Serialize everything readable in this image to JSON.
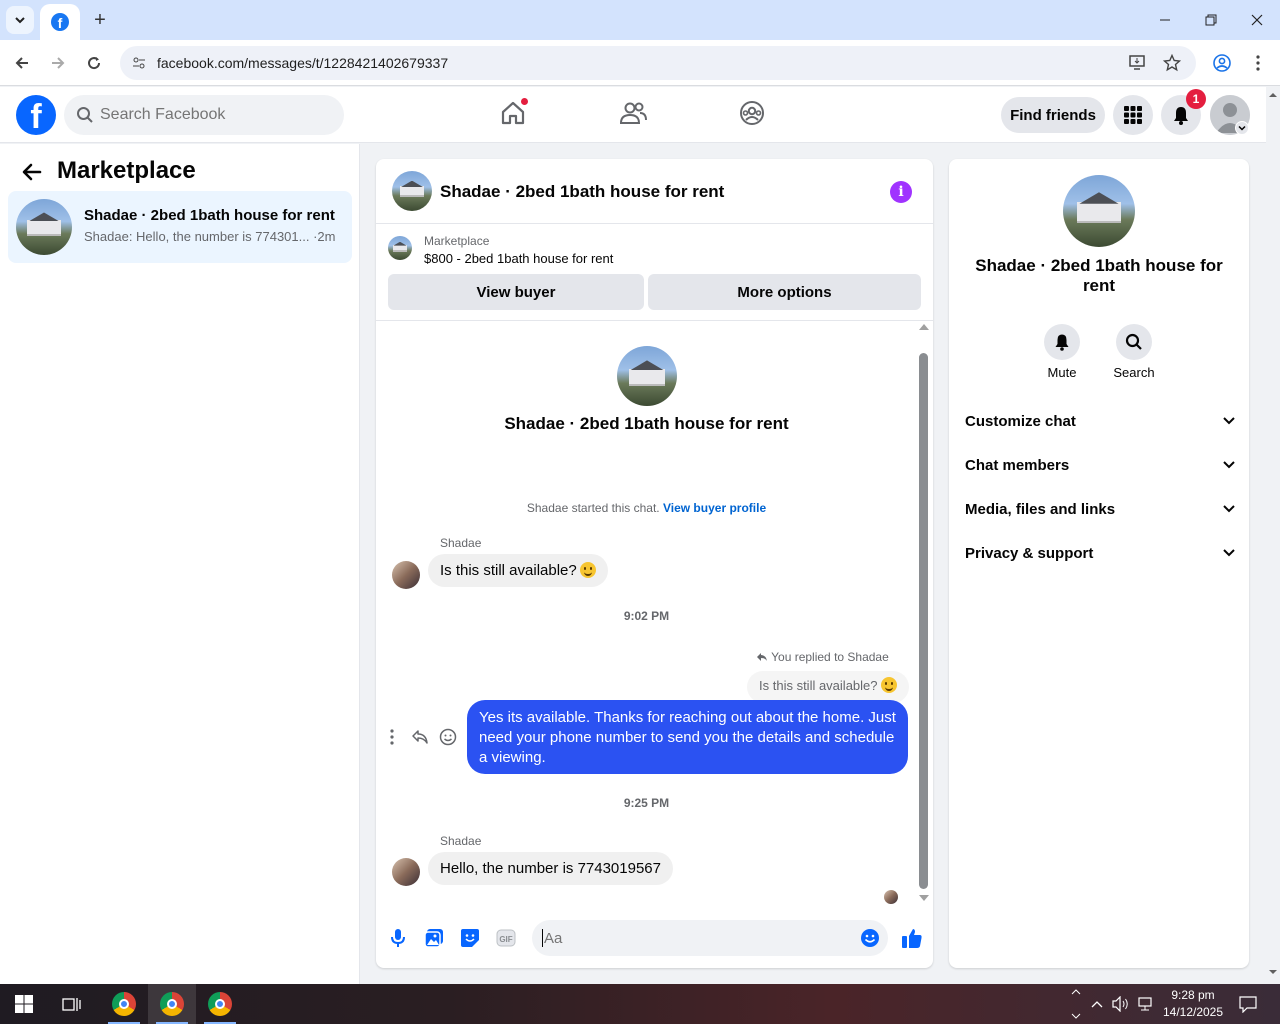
{
  "browser": {
    "url": "facebook.com/messages/t/1228421402679337"
  },
  "header": {
    "search_placeholder": "Search Facebook",
    "find_friends": "Find friends",
    "notif_count": "1"
  },
  "left": {
    "title": "Marketplace",
    "conversation": {
      "name": "Shadae · 2bed 1bath house for rent",
      "preview": "Shadae: Hello, the number is 774301... ·2m"
    }
  },
  "chat": {
    "title": "Shadae · 2bed 1bath house for rent",
    "marketplace_label": "Marketplace",
    "listing": "$800 - 2bed 1bath house for rent",
    "view_buyer": "View buyer",
    "more_options": "More options",
    "intro_title": "Shadae · 2bed 1bath house for rent",
    "started_text": "Shadae started this chat.",
    "view_buyer_profile": "View buyer profile",
    "messages": [
      {
        "sender": "Shadae",
        "text": "Is this still available?"
      },
      {
        "timestamp": "9:02 PM"
      },
      {
        "replied_label": "You replied to Shadae",
        "quoted": "Is this still available?",
        "text": "Yes its available. Thanks for reaching out about the home. Just need your phone number to send you the details and schedule a viewing."
      },
      {
        "timestamp": "9:25 PM"
      },
      {
        "sender": "Shadae",
        "text": "Hello, the number is 7743019567"
      }
    ],
    "composer_placeholder": "Aa"
  },
  "right": {
    "title": "Shadae · 2bed 1bath house for rent",
    "mute": "Mute",
    "search": "Search",
    "sections": [
      "Customize chat",
      "Chat members",
      "Media, files and links",
      "Privacy & support"
    ]
  },
  "taskbar": {
    "time": "9:28 pm",
    "date": "14/12/2025"
  },
  "colors": {
    "brand": "#0866ff",
    "outgoing_bubble": "#2b52f2",
    "link": "#0064d1",
    "badge": "#e41e3f"
  }
}
